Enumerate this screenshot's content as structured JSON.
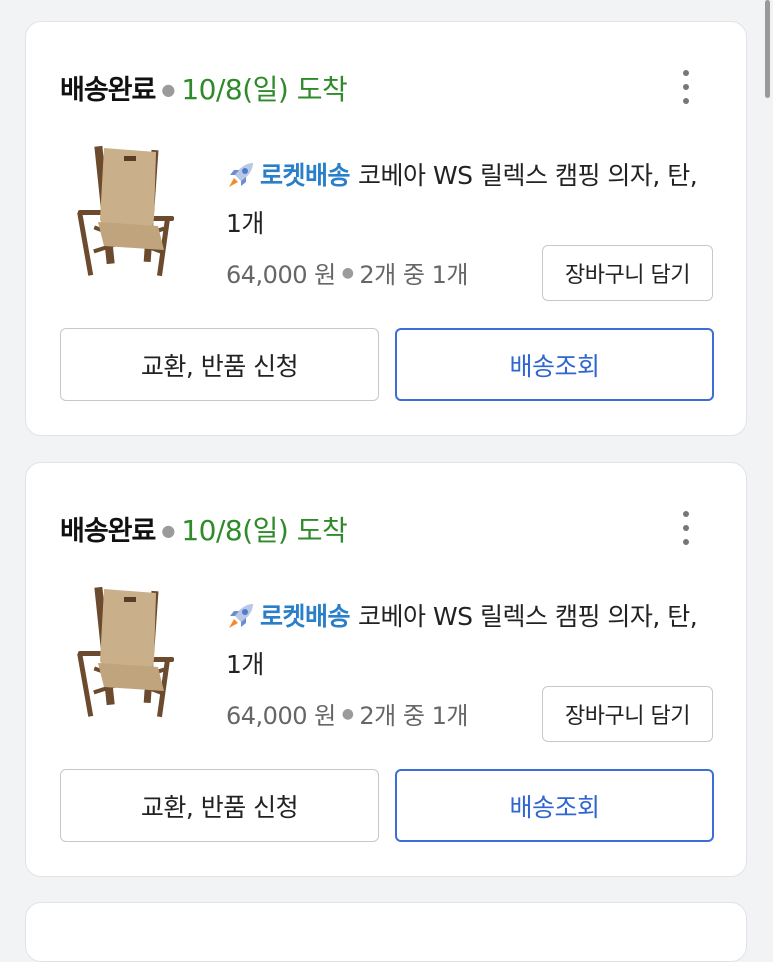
{
  "orders": [
    {
      "status": "배송완료",
      "date": "10/8(일) 도착",
      "delivery_badge": "로켓배송",
      "product_name": "코베아 WS 릴렉스 캠핑 의자, 탄, 1개",
      "price": "64,000 원",
      "quantity_info": "2개 중 1개",
      "cart_button": "장바구니 담기",
      "exchange_button": "교환, 반품 신청",
      "track_button": "배송조회"
    },
    {
      "status": "배송완료",
      "date": "10/8(일) 도착",
      "delivery_badge": "로켓배송",
      "product_name": "코베아 WS 릴렉스 캠핑 의자, 탄, 1개",
      "price": "64,000 원",
      "quantity_info": "2개 중 1개",
      "cart_button": "장바구니 담기",
      "exchange_button": "교환, 반품 신청",
      "track_button": "배송조회"
    }
  ],
  "colors": {
    "status_date": "#2f8a2a",
    "rocket_label": "#2a7fc9",
    "track_button_border": "#3b6fd6",
    "card_background": "#ffffff",
    "page_background": "#f2f3f5"
  },
  "icons": {
    "more": "vertical-ellipsis-icon",
    "rocket": "rocket-icon",
    "product": "camping-chair-image"
  }
}
